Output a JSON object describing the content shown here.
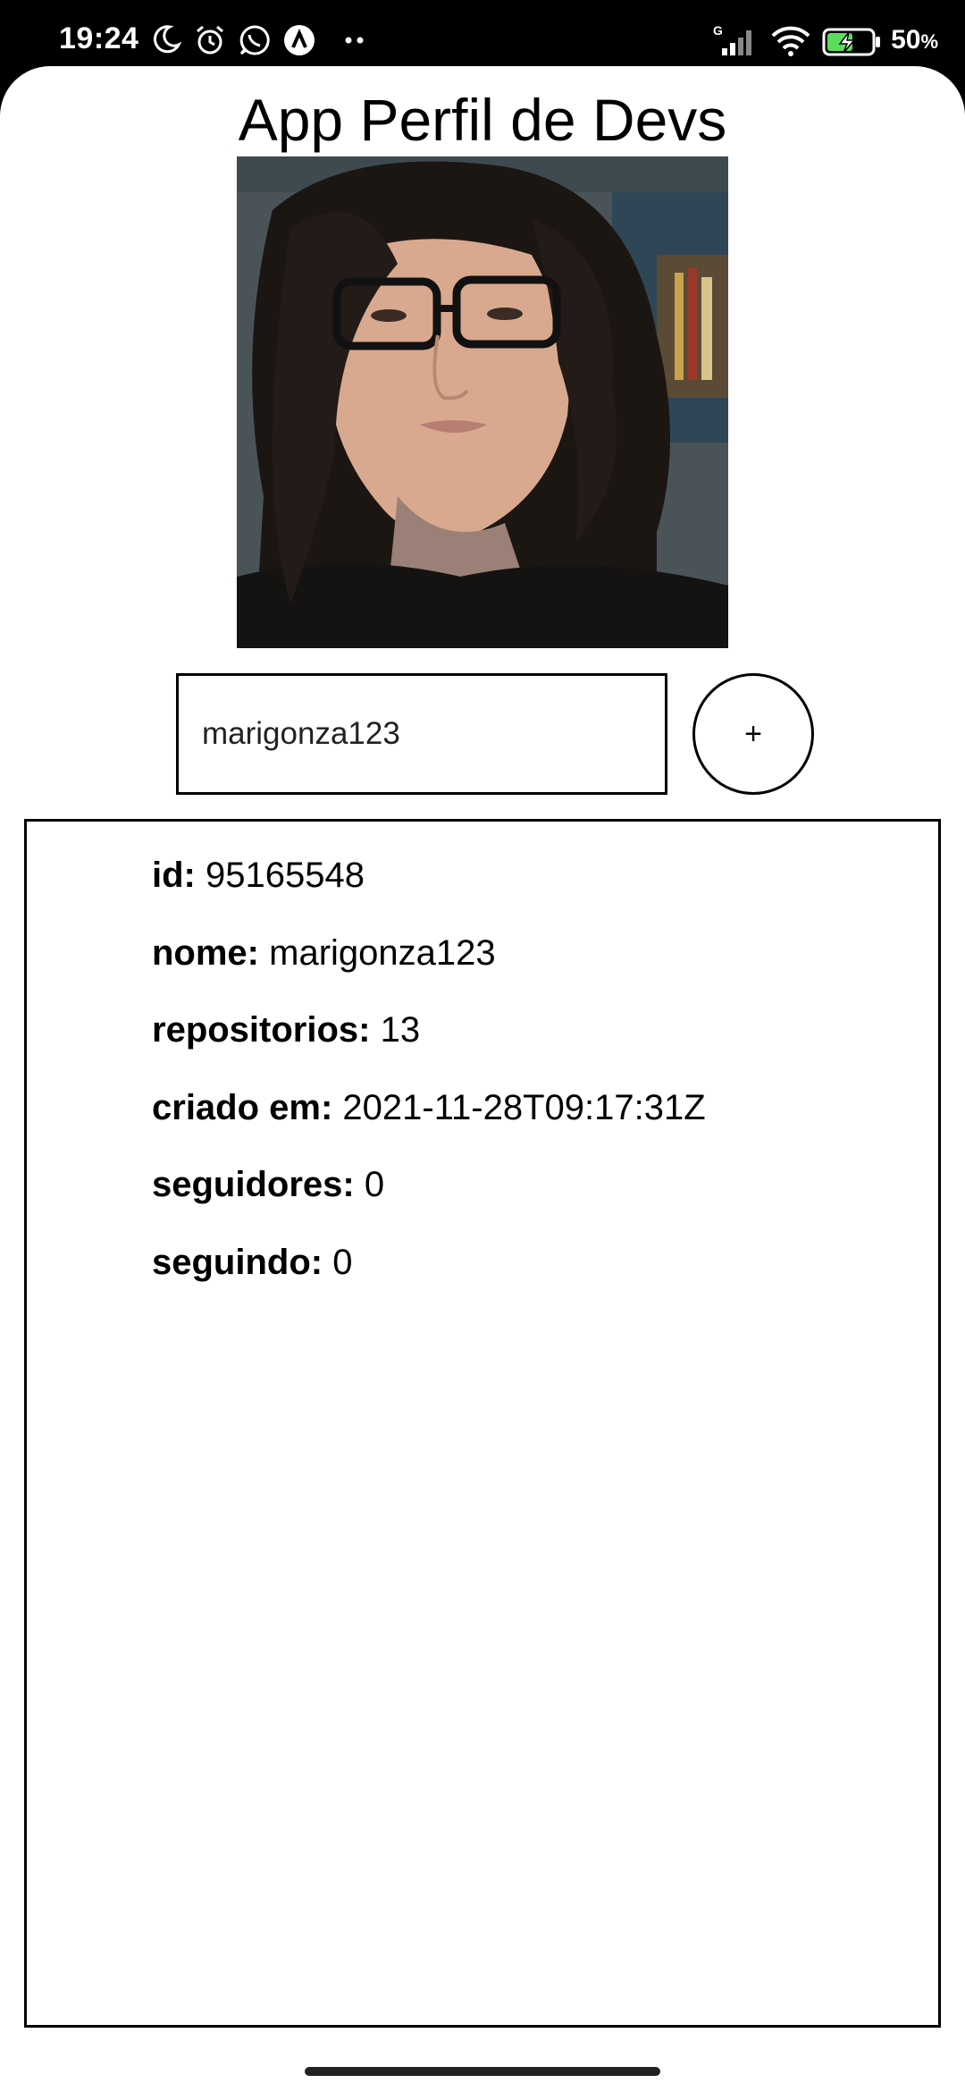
{
  "status_bar": {
    "time": "19:24",
    "battery_percent": "50",
    "battery_unit": "%",
    "network_label": "G",
    "icons": [
      "moon-icon",
      "alarm-icon",
      "whatsapp-icon",
      "app-notification-icon",
      "more-dots-icon",
      "signal-icon",
      "wifi-icon",
      "battery-charging-icon"
    ]
  },
  "app": {
    "title": "App Perfil de Devs",
    "search": {
      "value": "marigonza123",
      "placeholder": ""
    },
    "add_button_label": "+",
    "profile": [
      {
        "key": "id:",
        "value": "95165548"
      },
      {
        "key": "nome:",
        "value": "marigonza123"
      },
      {
        "key": "repositorios:",
        "value": "13"
      },
      {
        "key": "criado em:",
        "value": "2021-11-28T09:17:31Z"
      },
      {
        "key": "seguidores:",
        "value": "0"
      },
      {
        "key": "seguindo:",
        "value": "0"
      }
    ]
  },
  "colors": {
    "background": "#ffffff",
    "border": "#000000",
    "status_bar": "#000000"
  }
}
